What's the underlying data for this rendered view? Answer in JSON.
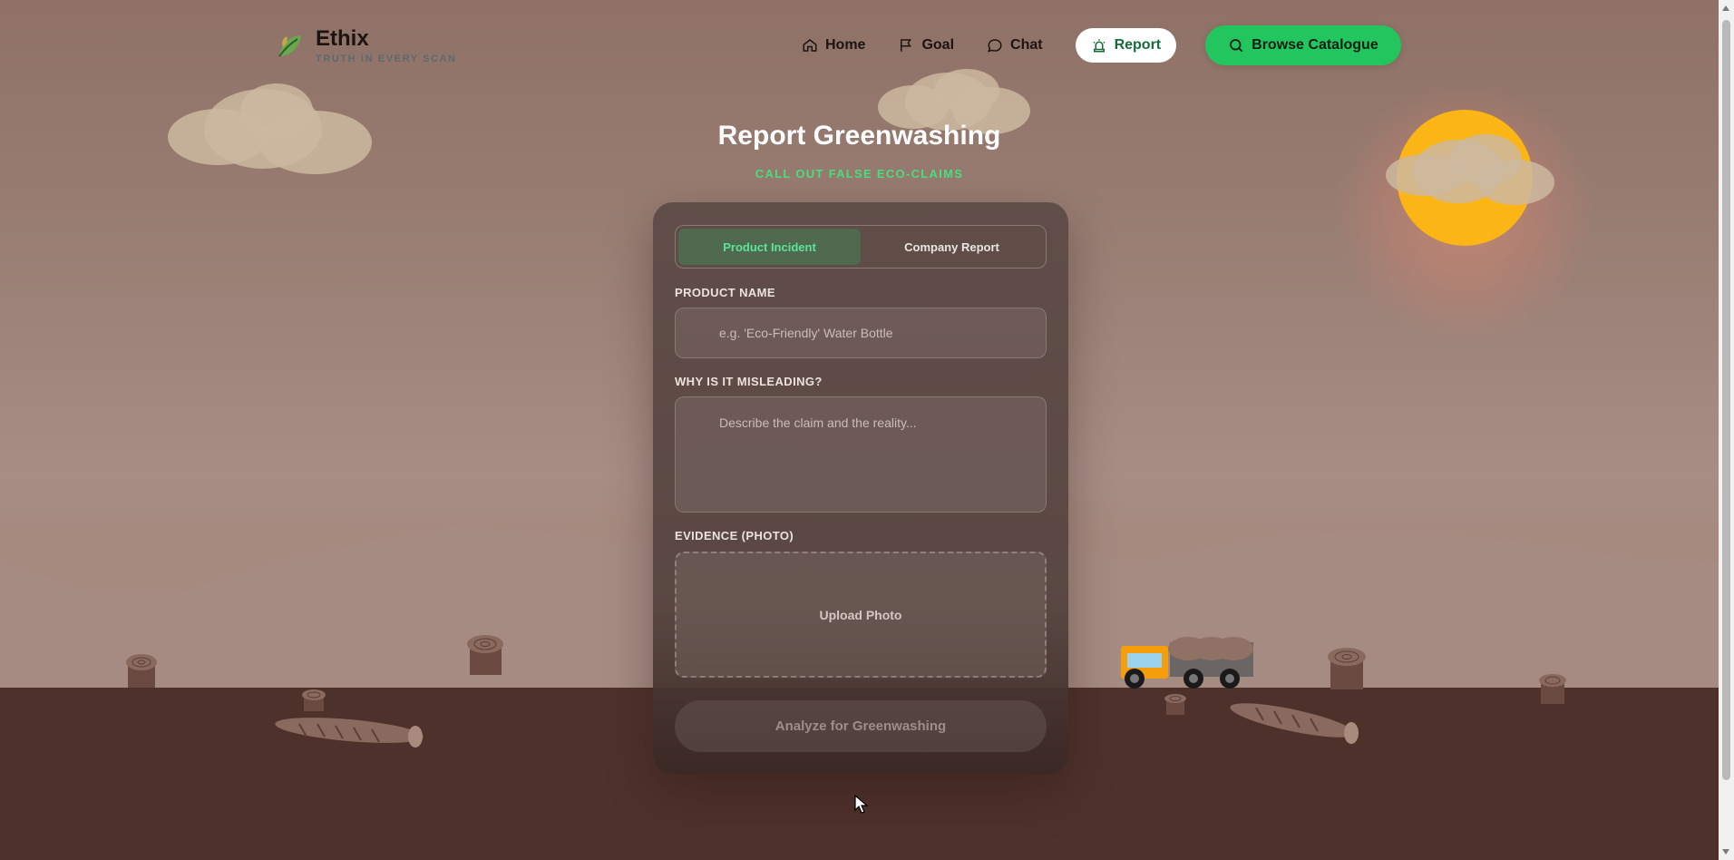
{
  "brand": {
    "name": "Ethix",
    "tagline": "TRUTH IN EVERY SCAN"
  },
  "nav": {
    "home": "Home",
    "goal": "Goal",
    "chat": "Chat",
    "report": "Report",
    "browse": "Browse Catalogue"
  },
  "page": {
    "title": "Report Greenwashing",
    "subtitle": "CALL OUT FALSE ECO-CLAIMS"
  },
  "form": {
    "tabs": {
      "product": "Product Incident",
      "company": "Company Report"
    },
    "product_name_label": "PRODUCT NAME",
    "product_name_placeholder": "e.g. 'Eco-Friendly' Water Bottle",
    "why_label": "WHY IS IT MISLEADING?",
    "why_placeholder": "Describe the claim and the reality...",
    "evidence_label": "EVIDENCE (PHOTO)",
    "upload_label": "Upload Photo",
    "submit_label": "Analyze for Greenwashing"
  },
  "colors": {
    "accent": "#22c55e",
    "accent_text": "#4ade80",
    "sun": "#fbb514",
    "ground": "#4f312c"
  },
  "icons": [
    "leaf-logo-icon",
    "home-icon",
    "flag-icon",
    "chat-bubble-icon",
    "alarm-icon",
    "search-icon"
  ]
}
